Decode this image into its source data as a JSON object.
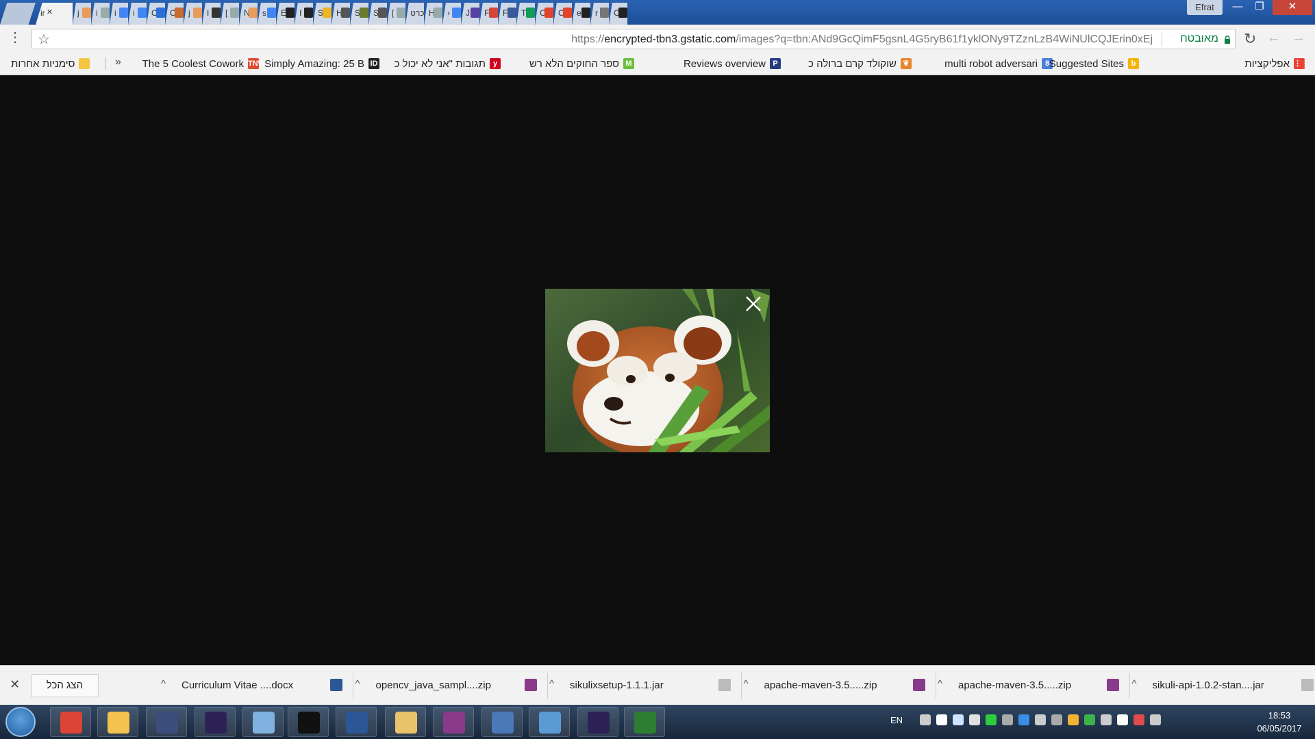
{
  "window": {
    "profile_name": "Efrat",
    "minimize": "—",
    "maximize": "❐",
    "close": "✕"
  },
  "tabs": [
    {
      "letter": "",
      "favicon": "new-tab",
      "color": "#b9c7db"
    },
    {
      "letter": "ir",
      "favicon": "close-icon",
      "color": "#f2f2f2",
      "active": true
    },
    {
      "letter": "j",
      "favicon": "pen-icon",
      "color": "#e89b5a"
    },
    {
      "letter": "i",
      "favicon": "doc-icon",
      "color": "#9aa"
    },
    {
      "letter": "i",
      "favicon": "google-icon",
      "color": "#4285f4"
    },
    {
      "letter": "i",
      "favicon": "google-icon",
      "color": "#4285f4"
    },
    {
      "letter": "C",
      "favicon": "bird-icon",
      "color": "#2a6fd6"
    },
    {
      "letter": "C",
      "favicon": "leaf-icon",
      "color": "#c96a2e"
    },
    {
      "letter": "j",
      "favicon": "pen-icon",
      "color": "#e89b5a"
    },
    {
      "letter": "I",
      "favicon": "cube-icon",
      "color": "#333"
    },
    {
      "letter": "[",
      "favicon": "doc-icon",
      "color": "#9aa"
    },
    {
      "letter": "N",
      "favicon": "pen-icon",
      "color": "#e89b5a"
    },
    {
      "letter": "s",
      "favicon": "google-icon",
      "color": "#4285f4"
    },
    {
      "letter": "E",
      "favicon": "github-icon",
      "color": "#222"
    },
    {
      "letter": "I",
      "favicon": "github-icon",
      "color": "#222"
    },
    {
      "letter": "S",
      "favicon": "ip-icon",
      "color": "#f0b323"
    },
    {
      "letter": "H",
      "favicon": "table-icon",
      "color": "#555"
    },
    {
      "letter": "S",
      "favicon": "bug-icon",
      "color": "#6c7a2b"
    },
    {
      "letter": "S",
      "favicon": "table-icon",
      "color": "#555"
    },
    {
      "letter": "[",
      "favicon": "doc-icon",
      "color": "#9aa"
    },
    {
      "letter": "כרט",
      "favicon": "none",
      "color": "#cfd8e6"
    },
    {
      "letter": "H",
      "favicon": "doc-icon",
      "color": "#9aa"
    },
    {
      "letter": "›",
      "favicon": "google-icon",
      "color": "#4285f4"
    },
    {
      "letter": "J",
      "favicon": "d-icon",
      "color": "#5b3fa0"
    },
    {
      "letter": "F",
      "favicon": "gmail-icon",
      "color": "#d44638"
    },
    {
      "letter": "F",
      "favicon": "facebook-icon",
      "color": "#3b5998"
    },
    {
      "letter": "T",
      "favicon": "sheets-icon",
      "color": "#0f9d58"
    },
    {
      "letter": "C",
      "favicon": "git-icon",
      "color": "#e24329"
    },
    {
      "letter": "C",
      "favicon": "git-icon",
      "color": "#e24329"
    },
    {
      "letter": "e",
      "favicon": "github-icon",
      "color": "#222"
    },
    {
      "letter": "r",
      "favicon": "slash-icon",
      "color": "#777"
    },
    {
      "letter": "C",
      "favicon": "github-icon",
      "color": "#222"
    }
  ],
  "toolbar": {
    "url_prefix": "https://",
    "url_domain": "encrypted-tbn3.gstatic.com",
    "url_rest": "/images?q=tbn:ANd9GcQimF5gsnL4G5ryB61f1yklONy9TZznLzB4WiNUlCQJErin0xEj",
    "secure_label": "מאובטח",
    "menu": "⋮",
    "star": "☆",
    "reload": "↻",
    "back": "←",
    "forward": "→"
  },
  "bookmarks": {
    "chevron": "»",
    "other": {
      "label": "סימניות אחרות",
      "icon": "folder-icon",
      "color": "#f5c542"
    },
    "items": [
      {
        "label": "The 5 Coolest Cowork",
        "icon": "tnw-icon",
        "color": "#e04a2f",
        "icon_text": "TNW"
      },
      {
        "label": "Simply Amazing: 25 B",
        "icon": "id-icon",
        "color": "#222",
        "icon_text": "ID"
      },
      {
        "label": "תגובות \"אני לא יכול כ",
        "icon": "ynet-icon",
        "color": "#d0021b",
        "icon_text": "y"
      },
      {
        "label": "ספר החוקים הלא רש",
        "icon": "m-icon",
        "color": "#6cbf3b",
        "icon_text": "M"
      },
      {
        "label": "Reviews overview",
        "icon": "paypal-icon",
        "color": "#253b80",
        "icon_text": "P"
      },
      {
        "label": "שוקולד קרם ברולה כ",
        "icon": "recipe-icon",
        "color": "#e8862a",
        "icon_text": "❦"
      },
      {
        "label": "multi robot adversari",
        "icon": "scholar-icon",
        "color": "#4a7fdc",
        "icon_text": "8"
      },
      {
        "label": "Suggested Sites",
        "icon": "bing-icon",
        "color": "#f4b400",
        "icon_text": "b"
      },
      {
        "label": "אפליקציות",
        "icon": "apps-icon",
        "color": "#e94335",
        "icon_text": "⋮⋮"
      }
    ]
  },
  "viewer": {
    "close_icon": "close-icon"
  },
  "downloads": {
    "close": "✕",
    "show_all": "הצג הכל",
    "items": [
      {
        "name": "Curriculum Vitae ....docx",
        "icon": "word-doc-icon",
        "color": "#2b5797"
      },
      {
        "name": "opencv_java_sampl....zip",
        "icon": "winrar-icon",
        "color": "#8a3a8a"
      },
      {
        "name": "sikulixsetup-1.1.1.jar",
        "icon": "file-icon",
        "color": "#bbbbbb"
      },
      {
        "name": "apache-maven-3.5.....zip",
        "icon": "winrar-icon",
        "color": "#8a3a8a"
      },
      {
        "name": "apache-maven-3.5.....zip",
        "icon": "winrar-icon",
        "color": "#8a3a8a"
      },
      {
        "name": "sikuli-api-1.0.2-stan....jar",
        "icon": "file-icon",
        "color": "#bbbbbb"
      }
    ],
    "chevron": "^"
  },
  "taskbar": {
    "apps": [
      {
        "name": "chrome-icon",
        "color": "#db4437"
      },
      {
        "name": "explorer-icon",
        "color": "#f3c24f"
      },
      {
        "name": "keepass-icon",
        "color": "#3b4d7a"
      },
      {
        "name": "eclipse-icon",
        "color": "#2c2255"
      },
      {
        "name": "notepad-icon",
        "color": "#7fb2df"
      },
      {
        "name": "cmd-icon",
        "color": "#111111"
      },
      {
        "name": "word-icon",
        "color": "#2b5797"
      },
      {
        "name": "paint-icon",
        "color": "#e8c36a"
      },
      {
        "name": "winrar-icon",
        "color": "#8a3a8a"
      },
      {
        "name": "network-icon",
        "color": "#4a78b8"
      },
      {
        "name": "remote-desktop-icon",
        "color": "#5a9bd5"
      },
      {
        "name": "eclipse-icon",
        "color": "#2c2255"
      },
      {
        "name": "monitor-icon",
        "color": "#2f7d32"
      }
    ],
    "lang": "EN",
    "tray_colors": [
      "#cccccc",
      "#ffffff",
      "#cfe2ff",
      "#e0e0e0",
      "#2ecc40",
      "#aaaaaa",
      "#3a8ee6",
      "#cccccc",
      "#aaaaaa",
      "#f2b233",
      "#3bb34a",
      "#cccccc",
      "#ffffff",
      "#e04b4b",
      "#cccccc"
    ],
    "time": "18:53",
    "date": "06/05/2017"
  }
}
